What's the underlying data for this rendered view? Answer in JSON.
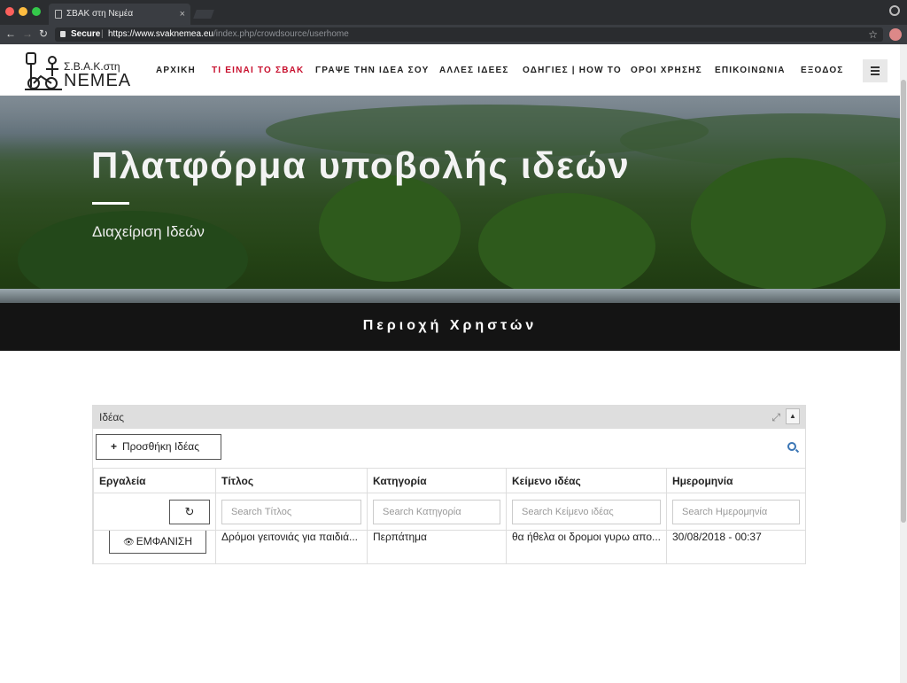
{
  "browser": {
    "tab_title": "ΣΒΑΚ στη Νεμέα",
    "tab_close": "×",
    "secure_label": "Secure",
    "url_host": "https://www.svaknemea.eu",
    "url_path": "/index.php/crowdsource/userhome"
  },
  "header": {
    "logo_top": "Σ.Β.Α.Κ.στη",
    "logo_bottom": "ΝΕΜΕΑ",
    "nav": [
      {
        "label": "ΑΡΧΙΚΗ"
      },
      {
        "label": "ΤΙ ΕΙΝΑΙ ΤΟ ΣΒΑΚ",
        "active": true
      },
      {
        "label": "ΓΡΑΨΕ ΤΗΝ ΙΔΕΑ ΣΟΥ"
      },
      {
        "label": "ΑΛΛΕΣ ΙΔΕΕΣ"
      },
      {
        "label": "ΟΔΗΓΙΕΣ | HOW TO"
      },
      {
        "label": "ΟΡΟΙ ΧΡΗΣΗΣ"
      },
      {
        "label": "ΕΠΙΚΟΙΝΩΝΙΑ"
      },
      {
        "label": "ΕΞΟΔΟΣ"
      }
    ]
  },
  "hero": {
    "title": "Πλατφόρμα υποβολής ιδεών",
    "subtitle": "Διαχείριση Ιδεών"
  },
  "band": {
    "title": "Περιοχή Χρηστών"
  },
  "panel": {
    "title": "Ιδέας",
    "add_button": "Προσθήκη Ιδέας",
    "columns": [
      "Εργαλεία",
      "Τίτλος",
      "Κατηγορία",
      "Κείμενο ιδέας",
      "Ημερομηνία"
    ],
    "filters": [
      "Search Τίτλος",
      "Search Κατηγορία",
      "Search Κείμενο ιδέας",
      "Search Ημερομηνία"
    ],
    "rows": [
      {
        "action": "ΕΜΦΑΝΙΣΗ",
        "title": "Δρόμοι γειτονιάς για παιδιά...",
        "category": "Περπάτημα",
        "text": "θα ήθελα οι δρομοι γυρω απο...",
        "date": "30/08/2018 - 00:37"
      }
    ]
  }
}
